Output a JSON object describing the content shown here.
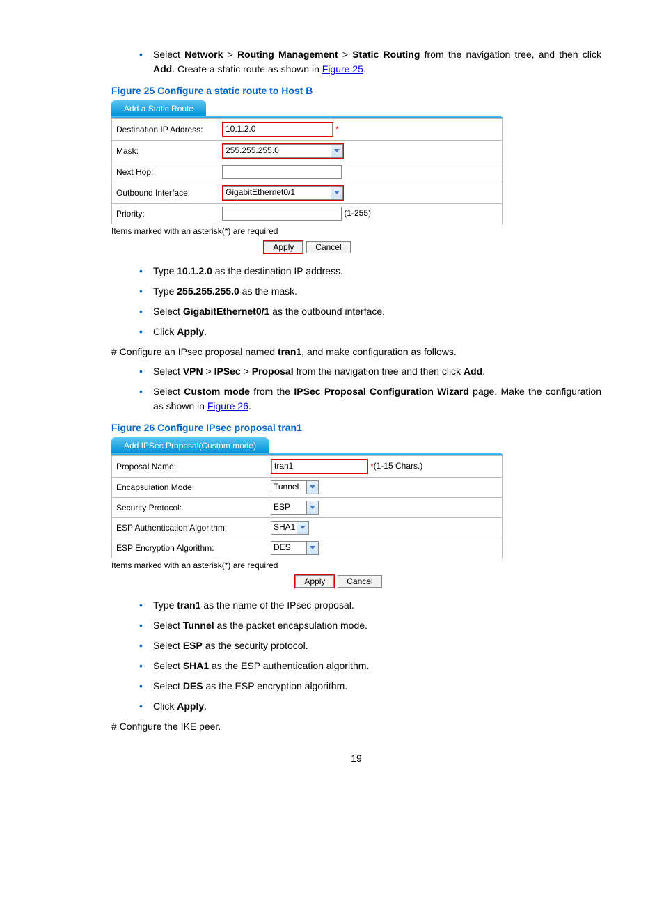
{
  "para1": {
    "pre": "Select ",
    "b1": "Network",
    "gt1": " > ",
    "b2": "Routing Management",
    "gt2": " > ",
    "b3": "Static Routing",
    "mid": " from the navigation tree, and then click ",
    "b4": "Add",
    "post": ". Create a static route as shown in ",
    "link": "Figure 25",
    "end": "."
  },
  "fig25": {
    "title": "Figure 25 Configure a static route to Host B",
    "tab": "Add a Static Route",
    "rows": {
      "r1": {
        "label": "Destination IP Address:",
        "value": "10.1.2.0"
      },
      "r2": {
        "label": "Mask:",
        "value": "255.255.255.0"
      },
      "r3": {
        "label": "Next Hop:",
        "value": ""
      },
      "r4": {
        "label": "Outbound Interface:",
        "value": "GigabitEthernet0/1"
      },
      "r5": {
        "label": "Priority:",
        "value": "",
        "hint": "(1-255)"
      }
    },
    "footnote": "Items marked with an asterisk(*) are required",
    "apply": "Apply",
    "cancel": "Cancel"
  },
  "list2": {
    "i1": {
      "a": "Type ",
      "b": "10.1.2.0",
      "c": " as the destination IP address."
    },
    "i2": {
      "a": "Type ",
      "b": "255.255.255.0",
      "c": " as the mask."
    },
    "i3": {
      "a": "Select ",
      "b": "GigabitEthernet0/1",
      "c": " as the outbound interface."
    },
    "i4": {
      "a": "Click ",
      "b": "Apply",
      "c": "."
    }
  },
  "hash1": {
    "a": "# Configure an IPsec proposal named ",
    "b": "tran1",
    "c": ", and make configuration as follows."
  },
  "list3": {
    "i1": {
      "a": "Select ",
      "b1": "VPN",
      "g1": " > ",
      "b2": "IPSec",
      "g2": " > ",
      "b3": "Proposal",
      "mid": " from the navigation tree and then click ",
      "b4": "Add",
      "end": "."
    },
    "i2": {
      "a": "Select ",
      "b1": "Custom mode",
      "mid": " from the ",
      "b2": "IPSec Proposal Configuration Wizard",
      "post": " page. Make the configuration as shown in ",
      "link": "Figure 26",
      "end": "."
    }
  },
  "fig26": {
    "title": "Figure 26 Configure IPsec proposal tran1",
    "tab": "Add IPSec Proposal(Custom mode)",
    "rows": {
      "r1": {
        "label": "Proposal Name:",
        "value": "tran1",
        "hint": "(1-15 Chars.)"
      },
      "r2": {
        "label": "Encapsulation Mode:",
        "value": "Tunnel"
      },
      "r3": {
        "label": "Security Protocol:",
        "value": "ESP"
      },
      "r4": {
        "label": "ESP Authentication Algorithm:",
        "value": "SHA1"
      },
      "r5": {
        "label": "ESP Encryption Algorithm:",
        "value": "DES"
      }
    },
    "footnote": "Items marked with an asterisk(*) are required",
    "apply": "Apply",
    "cancel": "Cancel"
  },
  "list4": {
    "i1": {
      "a": "Type ",
      "b": "tran1",
      "c": " as the name of the IPsec proposal."
    },
    "i2": {
      "a": "Select ",
      "b": "Tunnel",
      "c": " as the packet encapsulation mode."
    },
    "i3": {
      "a": "Select ",
      "b": "ESP",
      "c": " as the security protocol."
    },
    "i4": {
      "a": "Select ",
      "b": "SHA1",
      "c": " as the ESP authentication algorithm."
    },
    "i5": {
      "a": "Select ",
      "b": "DES",
      "c": " as the ESP encryption algorithm."
    },
    "i6": {
      "a": "Click ",
      "b": "Apply",
      "c": "."
    }
  },
  "hash2": "# Configure the IKE peer.",
  "pageNum": "19"
}
